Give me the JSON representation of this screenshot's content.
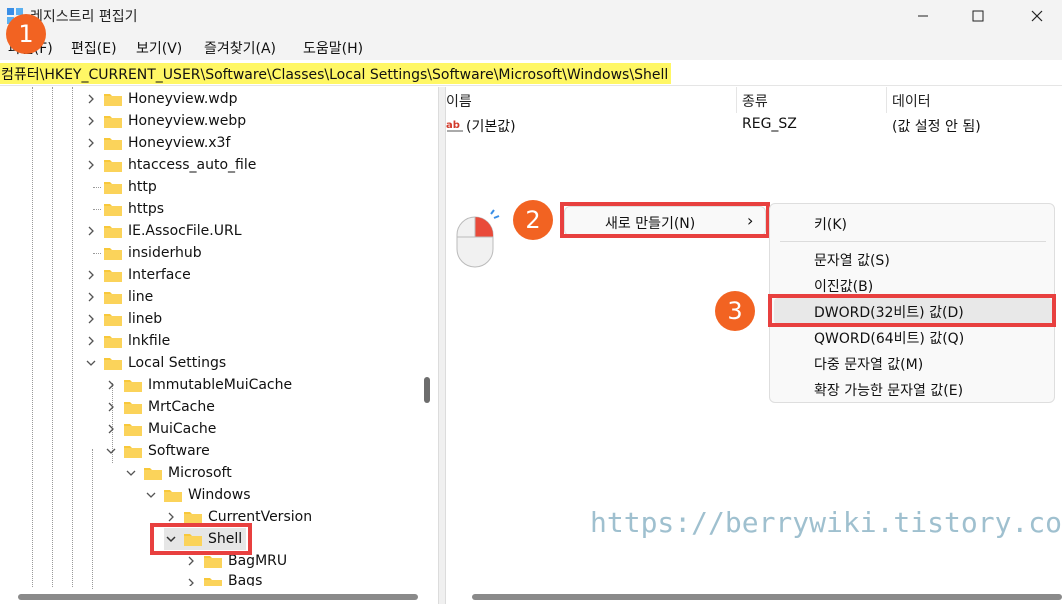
{
  "window": {
    "title": "레지스트리 편집기"
  },
  "menu": [
    "파일(F)",
    "편집(E)",
    "보기(V)",
    "즐겨찾기(A)",
    "도움말(H)"
  ],
  "address": {
    "path": "컴퓨터\\HKEY_CURRENT_USER\\Software\\Classes\\Local Settings\\Software\\Microsoft\\Windows\\Shell"
  },
  "tree": {
    "items": [
      {
        "label": "Honeyview.wdp"
      },
      {
        "label": "Honeyview.webp"
      },
      {
        "label": "Honeyview.x3f"
      },
      {
        "label": "htaccess_auto_file"
      },
      {
        "label": "http"
      },
      {
        "label": "https"
      },
      {
        "label": "IE.AssocFile.URL"
      },
      {
        "label": "insiderhub"
      },
      {
        "label": "Interface"
      },
      {
        "label": "line"
      },
      {
        "label": "lineb"
      },
      {
        "label": "lnkfile"
      },
      {
        "label": "Local Settings"
      },
      {
        "label": "ImmutableMuiCache"
      },
      {
        "label": "MrtCache"
      },
      {
        "label": "MuiCache"
      },
      {
        "label": "Software"
      },
      {
        "label": "Microsoft"
      },
      {
        "label": "Windows"
      },
      {
        "label": "CurrentVersion"
      },
      {
        "label": "Shell"
      },
      {
        "label": "BagMRU"
      },
      {
        "label": "Bags"
      }
    ]
  },
  "list": {
    "columns": [
      "이름",
      "종류",
      "데이터"
    ],
    "rows": [
      {
        "name": "(기본값)",
        "type": "REG_SZ",
        "data": "(값 설정 안 됨)"
      }
    ]
  },
  "badges": [
    "1",
    "2",
    "3"
  ],
  "context_menu": {
    "new_label": "새로 만들기(N)",
    "new_arrow": "›"
  },
  "submenu": [
    "키(K)",
    "문자열 값(S)",
    "이진값(B)",
    "DWORD(32비트) 값(D)",
    "QWORD(64비트) 값(Q)",
    "다중 문자열 값(M)",
    "확장 가능한 문자열 값(E)"
  ],
  "watermark": "https://berrywiki.tistory.com",
  "colors": {
    "highlight_yellow": "#fff765",
    "badge_orange": "#f26322",
    "annotation_red": "#e8403f",
    "folder_yellow": "#f8c83a"
  }
}
